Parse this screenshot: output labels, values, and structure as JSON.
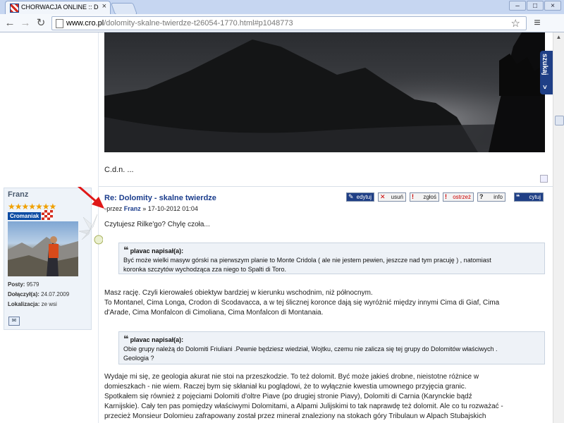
{
  "browser": {
    "tab_title": "CHORWACJA ONLINE :: Dol",
    "url_host": "www.cro.pl",
    "url_path": "/dolomity-skalne-twierdze-t26054-1770.html#p1048773"
  },
  "sidebar_search": {
    "label": "szukaj"
  },
  "previous_post": {
    "ending_text": "C.d.n. ..."
  },
  "author": {
    "name": "Franz",
    "stars": "★★★★★★★",
    "rank": "Cromaniak",
    "posts_label": "Posty:",
    "posts_value": "9579",
    "joined_label": "Dołączył(a):",
    "joined_value": "24.07.2009",
    "location_label": "Lokalizacja:",
    "location_value": "ze wsi"
  },
  "post": {
    "title": "Re: Dolomity - skalne twierdze",
    "meta_prefix": "przez",
    "meta_author": "Franz",
    "meta_date": "» 17-10-2012 01:04",
    "buttons": {
      "edit": "edytuj",
      "delete": "usuń",
      "report": "zgłoś",
      "warn": "ostrzeż",
      "info": "info",
      "quote": "cytuj"
    },
    "opening": "Czytujesz Rilke'go? Chylę czoła...",
    "quote1_author": "plavac napisał(a):",
    "quote1_line1": "Być może wielki masyw górski na pierwszym planie to Monte Cridola ( ale nie jestem pewien, jeszcze nad tym pracuję ) , natomiast",
    "quote1_line2": "koronka szczytów wychodząca zza niego to Spalti di Toro.",
    "para1_line1": "Masz rację. Czyli kierowałeś obiektyw bardziej w kierunku wschodnim, niż północnym.",
    "para1_line2": "To Montanel, Cima Longa, Crodon di Scodavacca, a w tej ślicznej koronce dają się wyróżnić między innymi Cima di Giaf, Cima",
    "para1_line3": "d'Arade, Cima Monfalcon di Cimoliana, Cima Monfalcon di Montanaia.",
    "quote2_author": "plavac napisał(a):",
    "quote2_line1": "Obie grupy należą do Dolomiti Friuliani .Pewnie będziesz wiedział, Wojtku, czemu nie zalicza się tej grupy do Dolomitów właściwych .",
    "quote2_line2": "Geologia ?",
    "para2_line1": "Wydaje mi się, ze geologia akurat nie stoi na przeszkodzie. To też dolomit. Być może jakieś drobne, nieistotne różnice w",
    "para2_line2": "domieszkach - nie wiem. Raczej bym się skłaniał ku poglądowi, że to wyłącznie kwestia umownego przyjęcia granic.",
    "para2_line3": "Spotkałem się również z pojęciami Dolomiti d'oltre Piave (po drugiej stronie Piavy), Dolomiti di Carnia (Karynckie bądź",
    "para2_line4": "Karnijskie). Cały ten pas pomiędzy właściwymi Dolomitami, a Alpami Julijskimi to tak naprawdę też dolomit. Ale co tu rozważać -",
    "para2_line5": "przecież Monsieur Dolomieu zafrapowany został przez minerał znaleziony na stokach góry Tribulaun w Alpach Stubajskich"
  },
  "colors": {
    "link_blue": "#1a3c8c",
    "rank_badge": "#0b4ba3",
    "arrow_red": "#e01818",
    "quote_bg": "#eef2f7"
  }
}
